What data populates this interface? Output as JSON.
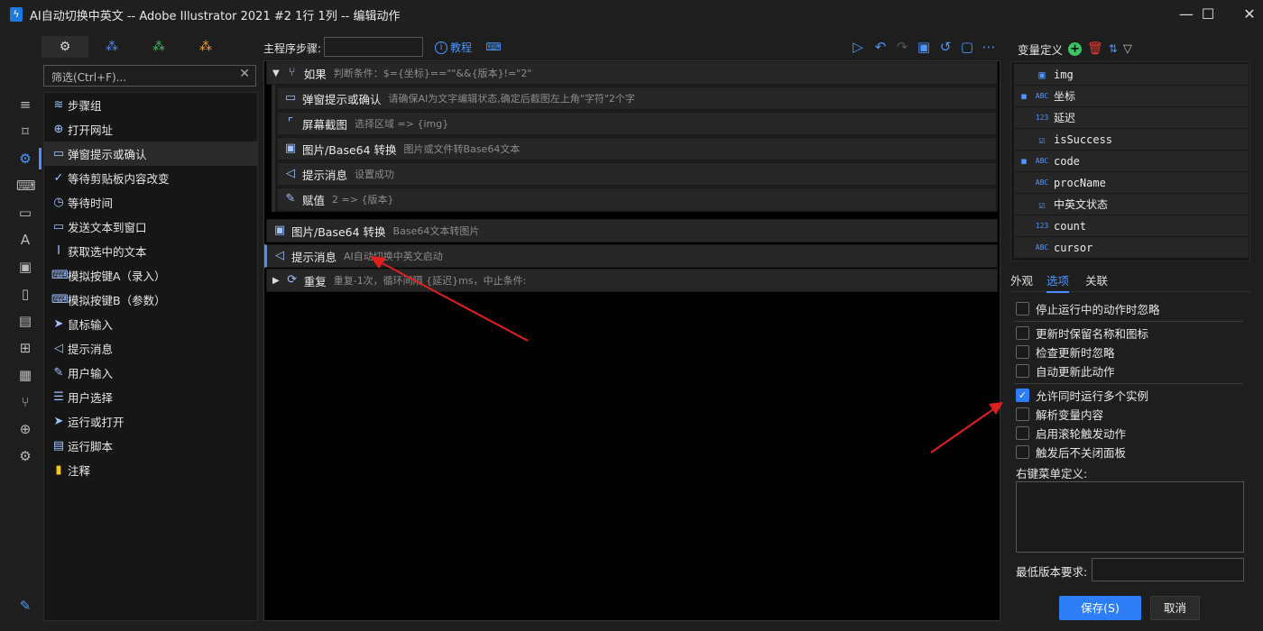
{
  "window": {
    "title": "AI自动切换中英文 -- Adobe Illustrator 2021 #2 1行 1列 -- 编辑动作",
    "app_icon": "lightning-icon",
    "minimize": "—",
    "maximize": "☐",
    "close": "✕"
  },
  "left": {
    "tabs": [
      {
        "icon": "gears-icon",
        "color": "#dddddd"
      },
      {
        "icon": "cubes-blue-icon",
        "color": "#4d8dff"
      },
      {
        "icon": "cubes-green-icon",
        "color": "#3cc463"
      },
      {
        "icon": "cubes-orange-icon",
        "color": "#f5a623"
      }
    ],
    "filter_placeholder": "筛选(Ctrl+F)...",
    "items": [
      {
        "label": "步骤组",
        "icon": "layers-icon"
      },
      {
        "label": "打开网址",
        "icon": "globe-icon"
      },
      {
        "label": "弹窗提示或确认",
        "icon": "dialog-icon"
      },
      {
        "label": "等待剪贴板内容改变",
        "icon": "clipboard-check-icon"
      },
      {
        "label": "等待时间",
        "icon": "timer-icon"
      },
      {
        "label": "发送文本到窗口",
        "icon": "message-icon"
      },
      {
        "label": "获取选中的文本",
        "icon": "text-cursor-icon"
      },
      {
        "label": "模拟按键A（录入）",
        "icon": "keyboard-icon"
      },
      {
        "label": "模拟按键B（参数）",
        "icon": "keyboard-icon"
      },
      {
        "label": "鼠标输入",
        "icon": "mouse-pointer-icon"
      },
      {
        "label": "提示消息",
        "icon": "megaphone-icon"
      },
      {
        "label": "用户输入",
        "icon": "user-input-icon"
      },
      {
        "label": "用户选择",
        "icon": "list-select-icon"
      },
      {
        "label": "运行或打开",
        "icon": "send-icon"
      },
      {
        "label": "运行脚本",
        "icon": "script-icon"
      },
      {
        "label": "注释",
        "icon": "note-icon"
      }
    ]
  },
  "rail": [
    "menu-icon",
    "bookmark-icon",
    "gear-icon",
    "keyboard-icon",
    "window-icon",
    "font-icon",
    "image-icon",
    "clipboard-icon",
    "file-icon",
    "windows-icon",
    "grid-icon",
    "branch-icon",
    "globe-icon",
    "gears-icon",
    "wrench-icon"
  ],
  "center": {
    "main_label": "主程序步骤:",
    "tutorial": "教程",
    "rows": [
      {
        "name": "如果",
        "desc": "判断条件：$={坐标}==\"\"&&{版本}!=\"2\"",
        "icon": "branch-icon"
      },
      {
        "name": "弹窗提示或确认",
        "desc": "请确保AI为文字编辑状态,确定后截图左上角\"字符\"2个字",
        "icon": "dialog-icon"
      },
      {
        "name": "屏幕截图",
        "desc": "选择区域 => {img}",
        "icon": "crop-icon"
      },
      {
        "name": "图片/Base64 转换",
        "desc": "图片或文件转Base64文本",
        "icon": "image-icon"
      },
      {
        "name": "提示消息",
        "desc": "设置成功",
        "icon": "megaphone-icon"
      },
      {
        "name": "赋值",
        "desc": "2 => {版本}",
        "icon": "edit-icon"
      },
      {
        "name": "图片/Base64 转换",
        "desc": "Base64文本转图片",
        "icon": "image-icon"
      },
      {
        "name": "提示消息",
        "desc": "AI自动切换中英文启动",
        "icon": "megaphone-icon"
      },
      {
        "name": "重复",
        "desc": "重复-1次，循环间隔 {延迟}ms，中止条件:",
        "icon": "loop-icon"
      }
    ]
  },
  "variables": {
    "title": "变量定义",
    "items": [
      {
        "name": "img",
        "type": "img",
        "lead": ""
      },
      {
        "name": "坐标",
        "type": "ABC",
        "lead": "save"
      },
      {
        "name": "延迟",
        "type": "123",
        "lead": ""
      },
      {
        "name": "isSuccess",
        "type": "bool",
        "lead": ""
      },
      {
        "name": "code",
        "type": "ABC",
        "lead": "save"
      },
      {
        "name": "procName",
        "type": "ABC",
        "lead": ""
      },
      {
        "name": "中英文状态",
        "type": "bool",
        "lead": ""
      },
      {
        "name": "count",
        "type": "123",
        "lead": ""
      },
      {
        "name": "cursor",
        "type": "ABC",
        "lead": ""
      }
    ]
  },
  "options": {
    "tabs": [
      "外观",
      "选项",
      "关联"
    ],
    "active_tab": "选项",
    "checks": [
      {
        "label": "停止运行中的动作时忽略",
        "checked": false
      },
      {
        "label": "更新时保留名称和图标",
        "checked": false
      },
      {
        "label": "检查更新时忽略",
        "checked": false
      },
      {
        "label": "自动更新此动作",
        "checked": false
      },
      {
        "label": "允许同时运行多个实例",
        "checked": true
      },
      {
        "label": "解析变量内容",
        "checked": false
      },
      {
        "label": "启用滚轮触发动作",
        "checked": false
      },
      {
        "label": "触发后不关闭面板",
        "checked": false
      }
    ],
    "context_menu_label": "右键菜单定义:",
    "min_version_label": "最低版本要求:",
    "save": "保存(S)",
    "cancel": "取消"
  },
  "colors": {
    "accent": "#2d7df6",
    "annotation": "#e02020"
  }
}
